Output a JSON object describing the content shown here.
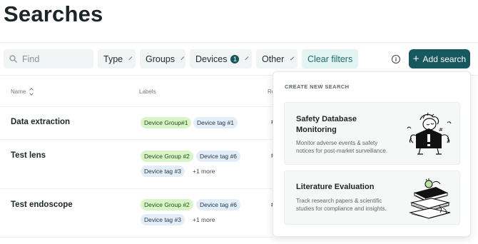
{
  "page": {
    "title": "Searches"
  },
  "filters": {
    "search_placeholder": "Find",
    "type_label": "Type",
    "groups_label": "Groups",
    "devices_label": "Devices",
    "devices_count": "1",
    "other_label": "Other",
    "clear_label": "Clear filters"
  },
  "actions": {
    "add_search_label": "Add search",
    "info_glyph": "i"
  },
  "table": {
    "headers": {
      "name": "Name",
      "labels": "Labels",
      "truncated": "Re"
    },
    "rows": [
      {
        "name": "Data extraction",
        "tags": [
          "Device Group#1",
          "Device tag #1"
        ],
        "more": "",
        "col3": "#"
      },
      {
        "name": "Test lens",
        "tags": [
          "Device Group #2",
          "Device tag #6",
          "Device tag #3"
        ],
        "more": "+1 more",
        "col3": "#"
      },
      {
        "name": "Test endoscope",
        "tags": [
          "Device Group #2",
          "Device tag #6",
          "Device tag #3"
        ],
        "more": "+1 more",
        "col3": "#"
      }
    ]
  },
  "dropdown": {
    "heading": "CREATE NEW SEARCH",
    "options": [
      {
        "title_line1": "Safety Database",
        "title_line2": "Monitoring",
        "desc_line1": "Monitor adverse events & safety",
        "desc_line2": "notices for post-market surveillance.",
        "icon": "alert-figure-illustration"
      },
      {
        "title_line1": "Literature Evaluation",
        "desc_line1": "Track research papers & scientific",
        "desc_line2": "studies for compliance and insights.",
        "icon": "book-stack-illustration"
      }
    ]
  },
  "colors": {
    "primary": "#17585f",
    "group_tag": "#d8f5c8",
    "device_tag": "#e3eef8",
    "clear_bg": "#e3f5f3"
  }
}
